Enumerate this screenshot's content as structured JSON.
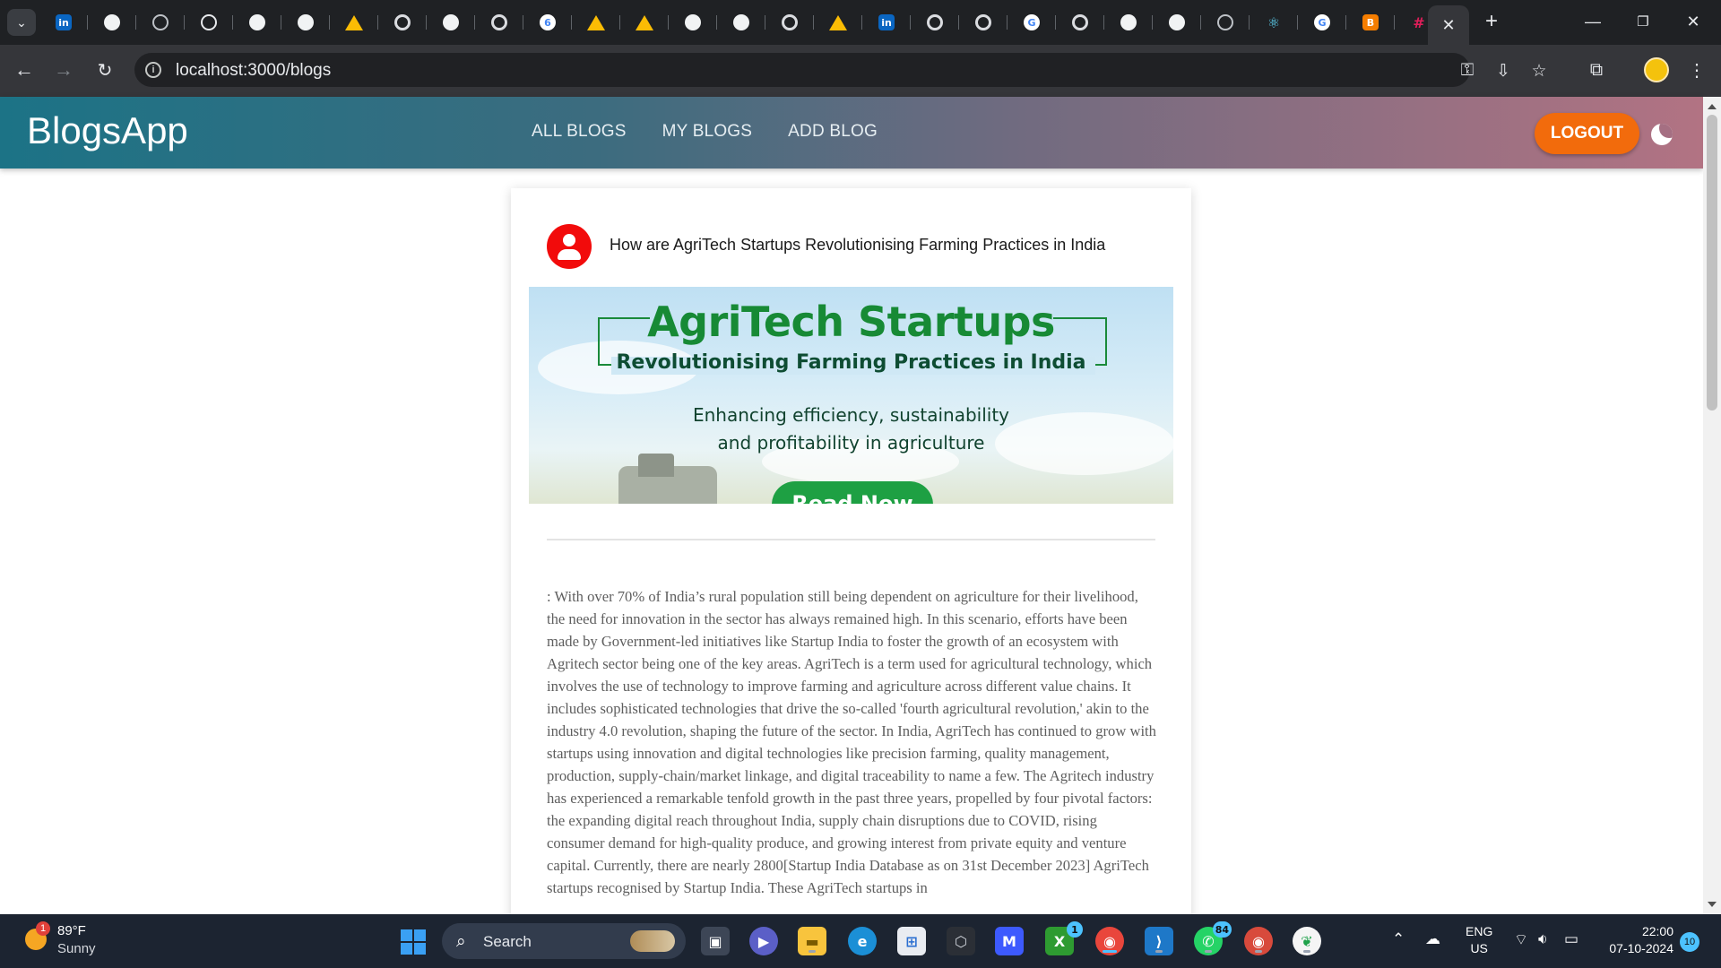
{
  "browser": {
    "tabs": [
      {
        "icon": "linkedin-icon",
        "kind": "li",
        "glyph": "in"
      },
      {
        "icon": "github-icon",
        "kind": "gh",
        "glyph": ""
      },
      {
        "icon": "globe-icon",
        "kind": "gl",
        "glyph": ""
      },
      {
        "icon": "chatgpt-icon",
        "kind": "ai",
        "glyph": ""
      },
      {
        "icon": "github-icon",
        "kind": "gh",
        "glyph": ""
      },
      {
        "icon": "github-icon",
        "kind": "gh",
        "glyph": ""
      },
      {
        "icon": "google-drive-icon",
        "kind": "dr",
        "glyph": ""
      },
      {
        "icon": "chrome-icon",
        "kind": "ch",
        "glyph": ""
      },
      {
        "icon": "github-icon",
        "kind": "gh",
        "glyph": ""
      },
      {
        "icon": "chrome-icon",
        "kind": "ch",
        "glyph": ""
      },
      {
        "icon": "page-icon",
        "kind": "gg",
        "glyph": "6"
      },
      {
        "icon": "google-drive-icon",
        "kind": "dr",
        "glyph": ""
      },
      {
        "icon": "google-drive-icon",
        "kind": "dr",
        "glyph": ""
      },
      {
        "icon": "github-icon",
        "kind": "gh",
        "glyph": ""
      },
      {
        "icon": "github-icon",
        "kind": "gh",
        "glyph": ""
      },
      {
        "icon": "chrome-icon",
        "kind": "ch",
        "glyph": ""
      },
      {
        "icon": "google-drive-icon",
        "kind": "dr",
        "glyph": ""
      },
      {
        "icon": "linkedin-icon",
        "kind": "li",
        "glyph": "in"
      },
      {
        "icon": "chrome-icon",
        "kind": "ch",
        "glyph": ""
      },
      {
        "icon": "chrome-icon",
        "kind": "ch",
        "glyph": ""
      },
      {
        "icon": "google-icon",
        "kind": "gg",
        "glyph": "G"
      },
      {
        "icon": "chrome-icon",
        "kind": "ch",
        "glyph": ""
      },
      {
        "icon": "github-icon",
        "kind": "gh",
        "glyph": ""
      },
      {
        "icon": "github-icon",
        "kind": "gh",
        "glyph": ""
      },
      {
        "icon": "globe-icon",
        "kind": "gl",
        "glyph": ""
      },
      {
        "icon": "react-icon",
        "kind": "rc",
        "glyph": "⚛"
      },
      {
        "icon": "google-icon",
        "kind": "gg",
        "glyph": "G"
      },
      {
        "icon": "blogger-icon",
        "kind": "bl",
        "glyph": "B"
      },
      {
        "icon": "slack-icon",
        "kind": "sl",
        "glyph": "#"
      }
    ],
    "url": "localhost:3000/blogs"
  },
  "app": {
    "brand": "BlogsApp",
    "nav": [
      "ALL BLOGS",
      "MY BLOGS",
      "ADD BLOG"
    ],
    "logout": "LOGOUT"
  },
  "blog": {
    "title": "How are AgriTech Startups Revolutionising Farming Practices in India",
    "banner": {
      "title": "AgriTech Startups",
      "subtitle": "Revolutionising Farming Practices in India",
      "tagline_1": "Enhancing efficiency, sustainability",
      "tagline_2": "and profitability in agriculture",
      "cta": "Read Now"
    },
    "content": ": With over 70% of India’s rural population still being dependent on agriculture for their livelihood, the need for innovation in the sector has always remained high. In this scenario, efforts have been made by Government-led initiatives like Startup India to foster the growth of an ecosystem with Agritech sector being one of the key areas. AgriTech is a term used for agricultural technology, which involves the use of technology to improve farming and agriculture across different value chains. It includes sophisticated technologies that drive the so-called 'fourth agricultural revolution,' akin to the industry 4.0 revolution, shaping the future of the sector. In India, AgriTech has continued to grow with startups using innovation and digital technologies like precision farming, quality management, production, supply-chain/market linkage, and digital traceability to name a few. The Agritech industry has experienced a remarkable tenfold growth in the past three years, propelled by four pivotal factors: the expanding digital reach throughout India, supply chain disruptions due to COVID, rising consumer demand for high-quality produce, and growing interest from private equity and venture capital. Currently, there are nearly 2800[Startup India Database as on 31st December 2023] AgriTech startups recognised by Startup India. These AgriTech startups in"
  },
  "taskbar": {
    "weather_temp": "89°F",
    "weather_desc": "Sunny",
    "weather_badge": "1",
    "search_label": "Search",
    "xbox_badge": "1",
    "whatsapp_badge": "84",
    "lang_1": "ENG",
    "lang_2": "US",
    "time": "22:00",
    "date": "07-10-2024",
    "notifications": "10"
  }
}
